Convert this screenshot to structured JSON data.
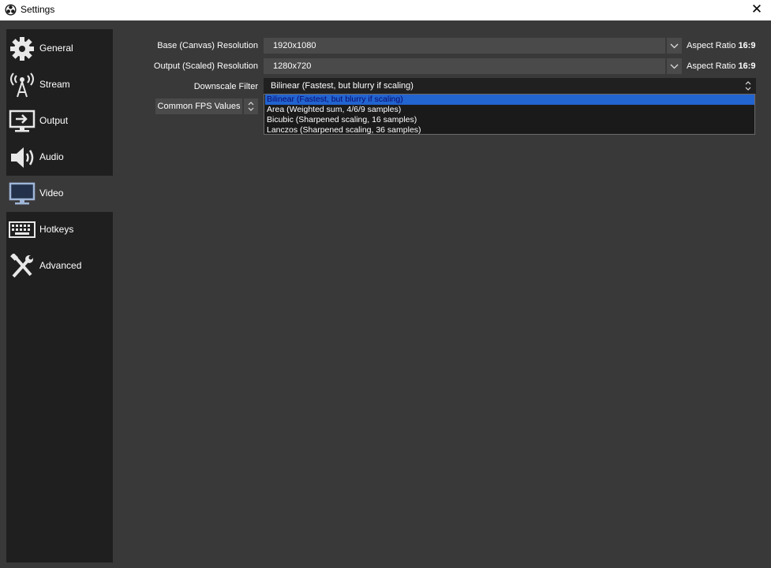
{
  "window": {
    "title": "Settings",
    "close_glyph": "✕"
  },
  "sidebar": {
    "items": [
      {
        "label": "General",
        "icon": "gear-icon"
      },
      {
        "label": "Stream",
        "icon": "broadcast-tower-icon"
      },
      {
        "label": "Output",
        "icon": "monitor-output-icon"
      },
      {
        "label": "Audio",
        "icon": "speaker-icon"
      },
      {
        "label": "Video",
        "icon": "monitor-icon",
        "active": true
      },
      {
        "label": "Hotkeys",
        "icon": "keyboard-icon"
      },
      {
        "label": "Advanced",
        "icon": "tools-icon"
      }
    ]
  },
  "video": {
    "base_resolution": {
      "label": "Base (Canvas) Resolution",
      "value": "1920x1080",
      "aspect_label": "Aspect Ratio",
      "aspect_value": "16:9"
    },
    "output_resolution": {
      "label": "Output (Scaled) Resolution",
      "value": "1280x720",
      "aspect_label": "Aspect Ratio",
      "aspect_value": "16:9"
    },
    "downscale_filter": {
      "label": "Downscale Filter",
      "value": "Bilinear (Fastest, but blurry if scaling)",
      "options": [
        "Bilinear (Fastest, but blurry if scaling)",
        "Area (Weighted sum, 4/6/9 samples)",
        "Bicubic (Sharpened scaling, 16 samples)",
        "Lanczos (Sharpened scaling, 36 samples)"
      ],
      "selected_index": 0
    },
    "fps": {
      "label": "Common FPS Values"
    }
  },
  "colors": {
    "background": "#3a393a",
    "sidebar": "#201f20",
    "control": "#4b4a4b",
    "highlight": "#2264d0"
  }
}
